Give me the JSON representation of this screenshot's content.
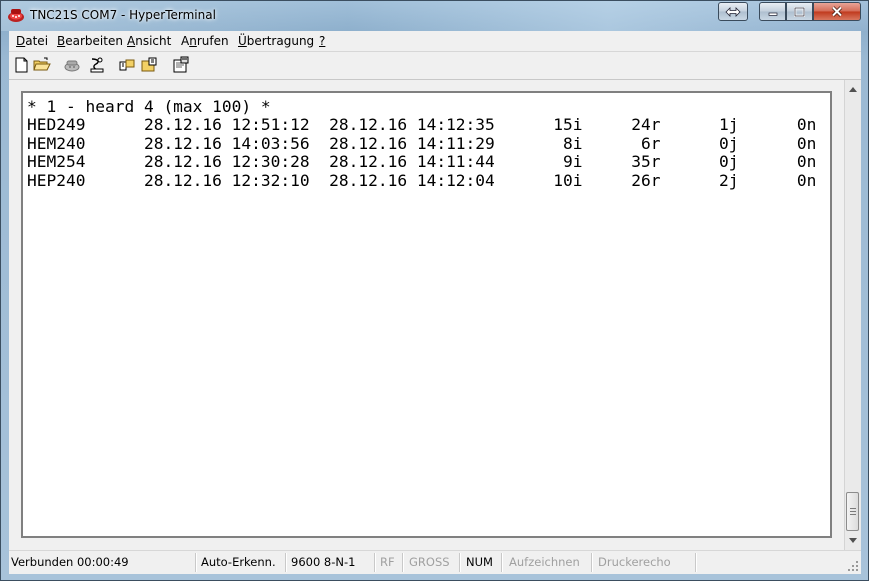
{
  "window": {
    "title": "TNC21S COM7 - HyperTerminal"
  },
  "menubar": {
    "items": [
      {
        "label": "Datei",
        "accel": "D"
      },
      {
        "label": "Bearbeiten",
        "accel": "B"
      },
      {
        "label": "Ansicht",
        "accel": "A"
      },
      {
        "label": "Anrufen",
        "accel": "n"
      },
      {
        "label": "Übertragung",
        "accel": "Ü"
      },
      {
        "label": "?",
        "accel": "?"
      }
    ]
  },
  "toolbar": {
    "icons": [
      "new-document-icon",
      "open-folder-icon",
      "connect-phone-icon",
      "disconnect-phone-icon",
      "send-file-icon",
      "receive-file-icon",
      "properties-icon"
    ]
  },
  "terminal": {
    "lines": [
      "* 1 - heard 4 (max 100) *",
      "HED249      28.12.16 12:51:12  28.12.16 14:12:35      15i     24r      1j      0n",
      "HEM240      28.12.16 14:03:56  28.12.16 14:11:29       8i      6r      0j      0n",
      "HEM254      28.12.16 12:30:28  28.12.16 14:11:44       9i     35r      0j      0n",
      "HEP240      28.12.16 12:32:10  28.12.16 14:12:04      10i     26r      2j      0n"
    ]
  },
  "statusbar": {
    "connected": "Verbunden 00:00:49",
    "detect": "Auto-Erkenn.",
    "settings": "9600 8-N-1",
    "rf": "RF",
    "caps": "GROSS",
    "num": "NUM",
    "capture": "Aufzeichnen",
    "print_echo": "Druckerecho"
  },
  "colors": {
    "title_glass": "#9bb9d3",
    "close_button": "#c0391c",
    "chrome": "#f0f0f0",
    "terminal_bg": "#ffffff",
    "status_disabled": "#a0a0a0"
  }
}
